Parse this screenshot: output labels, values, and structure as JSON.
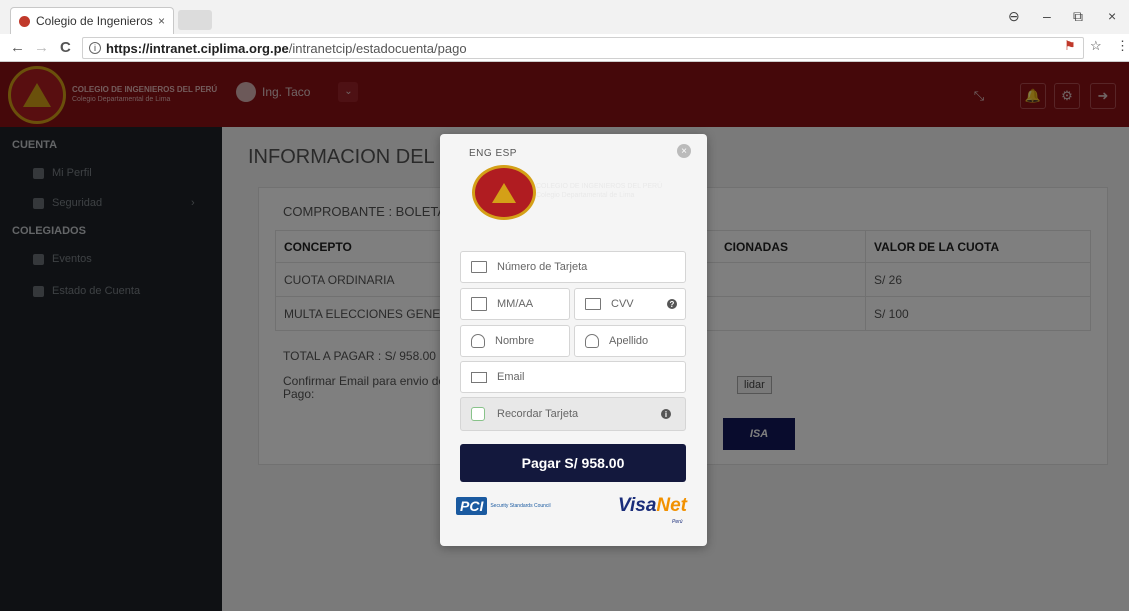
{
  "browser": {
    "tab_title": "Colegio de Ingenieros de",
    "tab_close": "×",
    "url_domain": "https://intranet.ciplima.org.pe",
    "url_path": "/intranetcip/estadocuenta/pago",
    "back": "←",
    "forward": "→",
    "reload": "C",
    "info_icon": "i",
    "account_icon": "⊖",
    "minimize": "–",
    "restore": "⧉",
    "close": "×",
    "ext_icon": "⚑",
    "star_icon": "☆",
    "menu_icon": "⋮"
  },
  "header": {
    "brand_line1": "COLEGIO DE INGENIEROS DEL PERÚ",
    "brand_line2": "Colegio Departamental de Lima",
    "user_name": "Ing. Taco",
    "user_dropdown": "⌄",
    "btn_expand": "⤡",
    "btn_bell": "🔔",
    "btn_settings": "⚙",
    "btn_logout": "➜"
  },
  "sidebar": {
    "section1": "CUENTA",
    "items1": [
      {
        "label": "Mi Perfil"
      },
      {
        "label": "Seguridad"
      }
    ],
    "chevron": "›",
    "section2": "COLEGIADOS",
    "items2": [
      {
        "label": "Eventos"
      },
      {
        "label": "Estado de Cuenta"
      }
    ]
  },
  "main": {
    "page_title": "INFORMACION DEL PA",
    "comprobante": "COMPROBANTE : BOLETA",
    "table": {
      "headers": [
        "CONCEPTO",
        "CIONADAS",
        "VALOR DE LA CUOTA"
      ],
      "rows": [
        [
          "CUOTA ORDINARIA",
          "",
          "S/ 26"
        ],
        [
          "MULTA ELECCIONES GENERA",
          "",
          "S/ 100"
        ]
      ]
    },
    "total": "TOTAL A PAGAR : S/ 958.00",
    "confirm": "Confirmar Email para envio de Pago:",
    "validar": "lidar",
    "visa_btn": "ISA"
  },
  "modal": {
    "lang": "ENG  ESP",
    "close_icon": "×",
    "brand_line1": "COLEGIO DE INGENIEROS DEL PERÚ",
    "brand_line2": "Colegio Departamental de Lima",
    "card_placeholder": "Número de Tarjeta",
    "expiry_placeholder": "MM/AA",
    "cvv_placeholder": "CVV",
    "help_icon": "?",
    "name_placeholder": "Nombre",
    "lastname_placeholder": "Apellido",
    "email_placeholder": "Email",
    "remember_label": "Recordar Tarjeta",
    "info_icon": "i",
    "pay_button": "Pagar S/ 958.00",
    "pci_logo": "PCI",
    "pci_sub": "Security Standards Council",
    "visanet_visa": "Visa",
    "visanet_net": "Net",
    "peru": "Perú"
  },
  "colors": {
    "brand_red": "#8b1015",
    "sidebar_bg": "#1e2328",
    "pay_button": "#13183d",
    "visanet_blue": "#1a2d7a",
    "visanet_orange": "#f29100"
  }
}
